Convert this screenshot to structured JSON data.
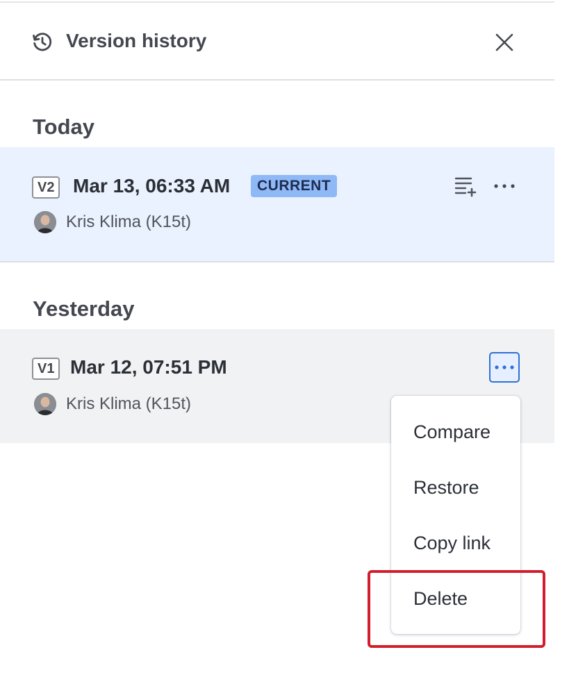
{
  "header": {
    "title": "Version history",
    "icon": "history-icon",
    "close_icon": "close-icon"
  },
  "sections": [
    {
      "label": "Today",
      "versions": [
        {
          "badge": "V2",
          "date": "Mar 13, 06:33 AM",
          "status": "CURRENT",
          "author": "Kris Klima (K15t)",
          "actions": [
            "restore-version-icon",
            "more-icon"
          ]
        }
      ]
    },
    {
      "label": "Yesterday",
      "versions": [
        {
          "badge": "V1",
          "date": "Mar 12, 07:51 PM",
          "author": "Kris Klima (K15t)",
          "actions": [
            "more-icon"
          ],
          "menu_open": true
        }
      ]
    }
  ],
  "menu": {
    "items": [
      "Compare",
      "Restore",
      "Copy link",
      "Delete"
    ],
    "highlighted_item": "Delete"
  },
  "colors": {
    "current_row_bg": "#e9f2fe",
    "hover_row_bg": "#f1f2f4",
    "current_badge_bg": "#8fb8f6",
    "focus_blue": "#2f6fd6",
    "highlight_red": "#d21e2b"
  }
}
